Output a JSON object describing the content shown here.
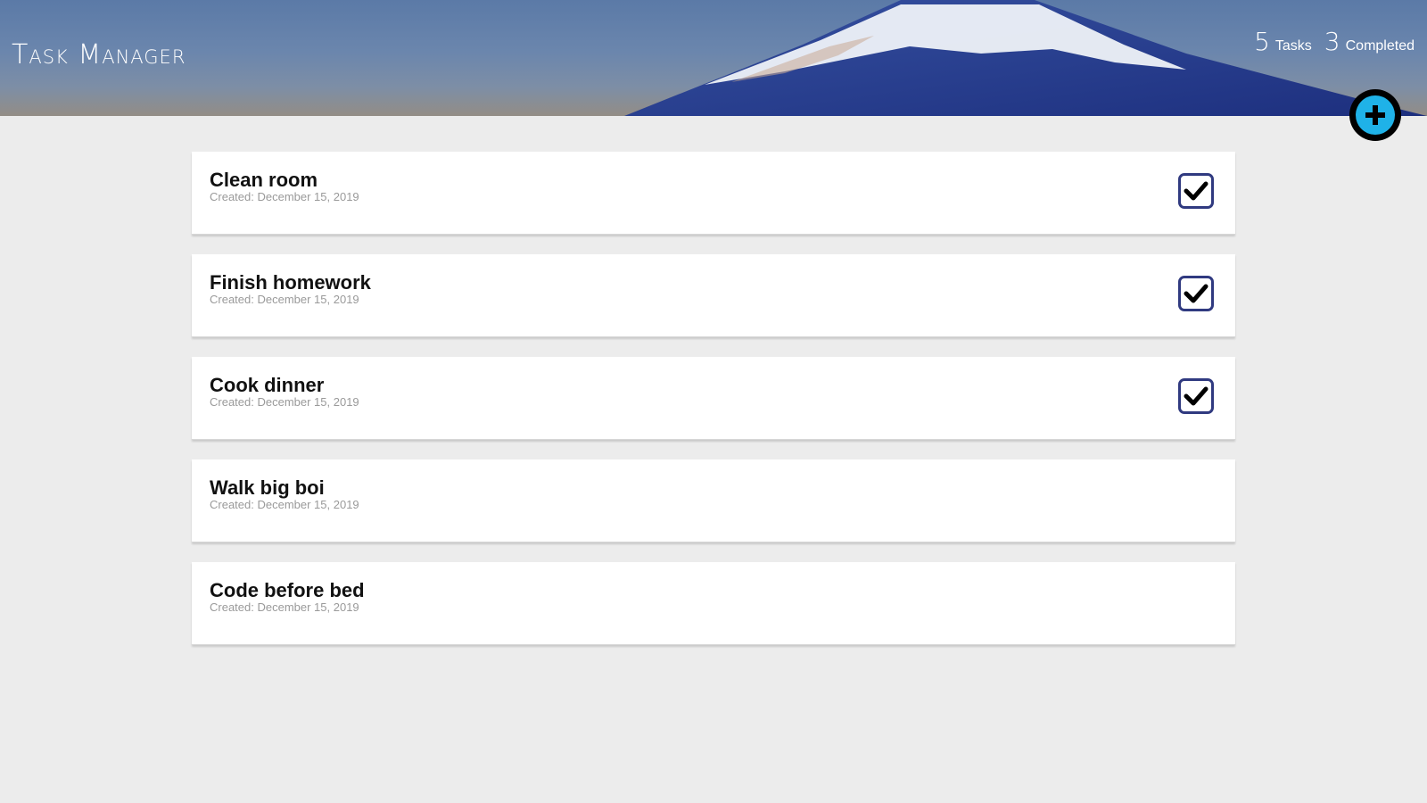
{
  "header": {
    "title": "Task Manager",
    "task_count": "5",
    "task_label": "Tasks",
    "completed_count": "3",
    "completed_label": "Completed"
  },
  "add_button": {
    "icon": "plus-circle-icon"
  },
  "colors": {
    "accent": "#1fb2e8",
    "checkbox_border": "#303a80",
    "background": "#ececec"
  },
  "tasks": [
    {
      "title": "Clean room",
      "created": "Created: December 15, 2019",
      "completed": true
    },
    {
      "title": "Finish homework",
      "created": "Created: December 15, 2019",
      "completed": true
    },
    {
      "title": "Cook dinner",
      "created": "Created: December 15, 2019",
      "completed": true
    },
    {
      "title": "Walk big boi",
      "created": "Created: December 15, 2019",
      "completed": false
    },
    {
      "title": "Code before bed",
      "created": "Created: December 15, 2019",
      "completed": false
    }
  ]
}
